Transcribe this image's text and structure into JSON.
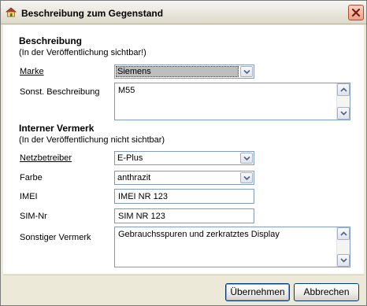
{
  "window": {
    "title": "Beschreibung zum Gegenstand"
  },
  "section_public": {
    "title": "Beschreibung",
    "hint": "(In der Veröffentlichung sichtbar!)",
    "brand_label": "Marke",
    "brand_value": "Siemens",
    "other_desc_label": "Sonst. Beschreibung",
    "other_desc_value": "M55"
  },
  "section_internal": {
    "title": "Interner Vermerk",
    "hint": "(In der Veröffentlichung nicht sichtbar)",
    "network_label": "Netzbetreiber",
    "network_value": "E-Plus",
    "color_label": "Farbe",
    "color_value": "anthrazit",
    "imei_label": "IMEI",
    "imei_value": "IMEI NR 123",
    "sim_label": "SIM-Nr",
    "sim_value": "SIM NR 123",
    "other_note_label": "Sonstiger Vermerk",
    "other_note_value": "Gebrauchsspuren und zerkratztes Display"
  },
  "buttons": {
    "apply": "Übernehmen",
    "cancel": "Abbrechen"
  },
  "icons": {
    "app": "app-icon",
    "close": "close-icon",
    "dropdown": "chevron-down-icon",
    "scroll_up": "scroll-up-icon",
    "scroll_down": "scroll-down-icon"
  },
  "colors": {
    "window_bg": "#ece9d8",
    "close_button": "#ec9d86",
    "field_border": "#7f9db9",
    "focus_fill": "#bdbebd"
  }
}
